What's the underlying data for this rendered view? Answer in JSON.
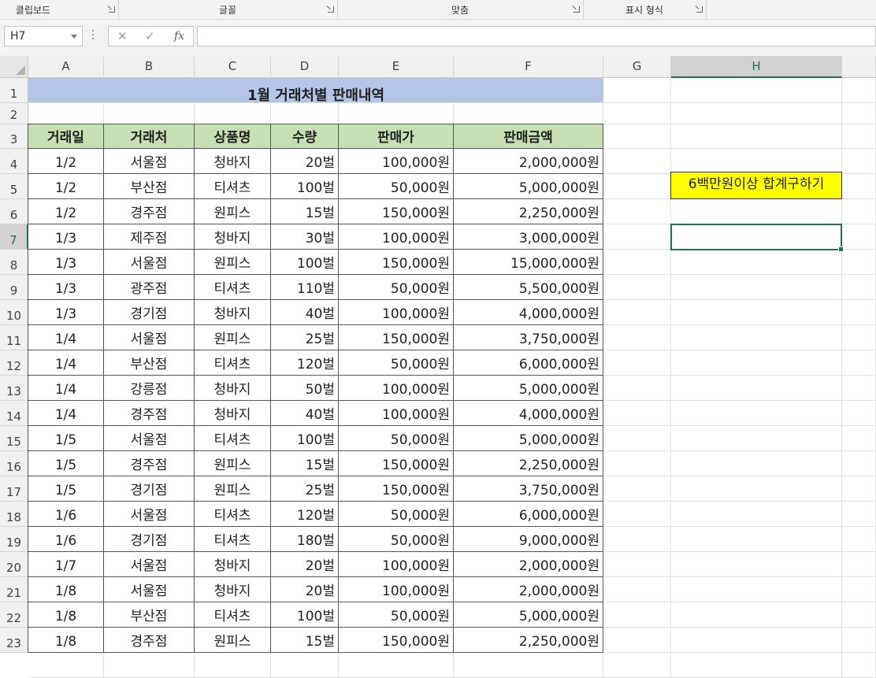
{
  "ribbon": {
    "groups": [
      "클립보드",
      "글꼴",
      "맞춤",
      "표시 형식"
    ]
  },
  "formula_bar": {
    "name_box": "H7",
    "cancel_icon": "✕",
    "enter_icon": "✓",
    "fx_label": "fx",
    "formula": ""
  },
  "sheet": {
    "columns": [
      "A",
      "B",
      "C",
      "D",
      "E",
      "F",
      "G",
      "H"
    ],
    "selected_column": "H",
    "rows": [
      "1",
      "2",
      "3",
      "4",
      "5",
      "6",
      "7",
      "8",
      "9",
      "10",
      "11",
      "12",
      "13",
      "14",
      "15",
      "16",
      "17",
      "18",
      "19",
      "20",
      "21",
      "22",
      "23"
    ],
    "selected_row": "7",
    "title": "1월 거래처별 판매내역",
    "headers": [
      "거래일",
      "거래처",
      "상품명",
      "수량",
      "판매가",
      "판매금액"
    ],
    "records": [
      [
        "1/2",
        "서울점",
        "청바지",
        "20벌",
        "100,000원",
        "2,000,000원"
      ],
      [
        "1/2",
        "부산점",
        "티셔츠",
        "100벌",
        "50,000원",
        "5,000,000원"
      ],
      [
        "1/2",
        "경주점",
        "원피스",
        "15벌",
        "150,000원",
        "2,250,000원"
      ],
      [
        "1/3",
        "제주점",
        "청바지",
        "30벌",
        "100,000원",
        "3,000,000원"
      ],
      [
        "1/3",
        "서울점",
        "원피스",
        "100벌",
        "150,000원",
        "15,000,000원"
      ],
      [
        "1/3",
        "광주점",
        "티셔츠",
        "110벌",
        "50,000원",
        "5,500,000원"
      ],
      [
        "1/3",
        "경기점",
        "청바지",
        "40벌",
        "100,000원",
        "4,000,000원"
      ],
      [
        "1/4",
        "서울점",
        "원피스",
        "25벌",
        "150,000원",
        "3,750,000원"
      ],
      [
        "1/4",
        "부산점",
        "티셔츠",
        "120벌",
        "50,000원",
        "6,000,000원"
      ],
      [
        "1/4",
        "강릉점",
        "청바지",
        "50벌",
        "100,000원",
        "5,000,000원"
      ],
      [
        "1/4",
        "경주점",
        "청바지",
        "40벌",
        "100,000원",
        "4,000,000원"
      ],
      [
        "1/5",
        "서울점",
        "티셔츠",
        "100벌",
        "50,000원",
        "5,000,000원"
      ],
      [
        "1/5",
        "경주점",
        "원피스",
        "15벌",
        "150,000원",
        "2,250,000원"
      ],
      [
        "1/5",
        "경기점",
        "원피스",
        "25벌",
        "150,000원",
        "3,750,000원"
      ],
      [
        "1/6",
        "서울점",
        "티셔츠",
        "120벌",
        "50,000원",
        "6,000,000원"
      ],
      [
        "1/6",
        "경기점",
        "티셔츠",
        "180벌",
        "50,000원",
        "9,000,000원"
      ],
      [
        "1/7",
        "서울점",
        "청바지",
        "20벌",
        "100,000원",
        "2,000,000원"
      ],
      [
        "1/8",
        "서울점",
        "청바지",
        "20벌",
        "100,000원",
        "2,000,000원"
      ],
      [
        "1/8",
        "부산점",
        "티셔츠",
        "100벌",
        "50,000원",
        "5,000,000원"
      ],
      [
        "1/8",
        "경주점",
        "원피스",
        "15벌",
        "150,000원",
        "2,250,000원"
      ]
    ],
    "note": "6백만원이상 합계구하기",
    "colors": {
      "title_fill": "#b4c6e7",
      "header_fill": "#c6e0b4",
      "note_fill": "#ffff00",
      "selection": "#217346"
    }
  }
}
